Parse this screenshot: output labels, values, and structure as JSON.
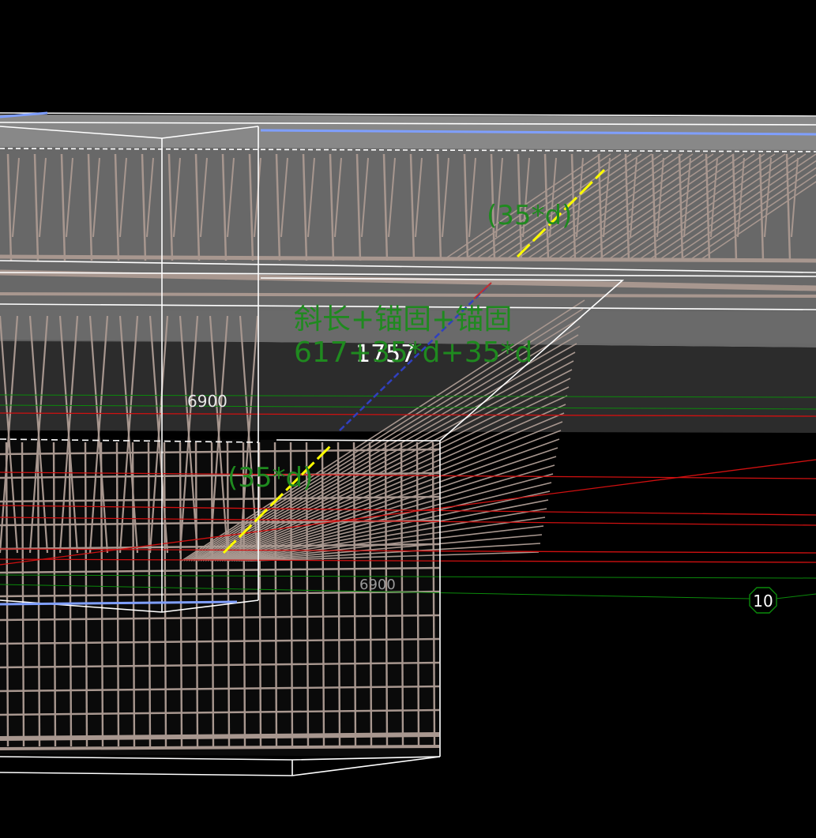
{
  "viewport": {
    "annotations": {
      "anchor_label_top": "(35*d)",
      "anchor_label_bottom": "(35*d)",
      "formula_line1": "斜长+锚固+锚固",
      "formula_line2": "617+35*d+35*d",
      "overlay_value": "1757",
      "dimension_upper": "6900",
      "dimension_lower": "6900",
      "axis_marker": "10"
    },
    "colors": {
      "background": "#000000",
      "rebar": "#a8978f",
      "edges": "#ffffff",
      "highlight_anchor": "#ffff00",
      "annotation_text": "#1f8a1f",
      "axis_green": "#0b8a0b",
      "axis_red": "#d01010",
      "blue_edge": "#7f9fff"
    }
  }
}
